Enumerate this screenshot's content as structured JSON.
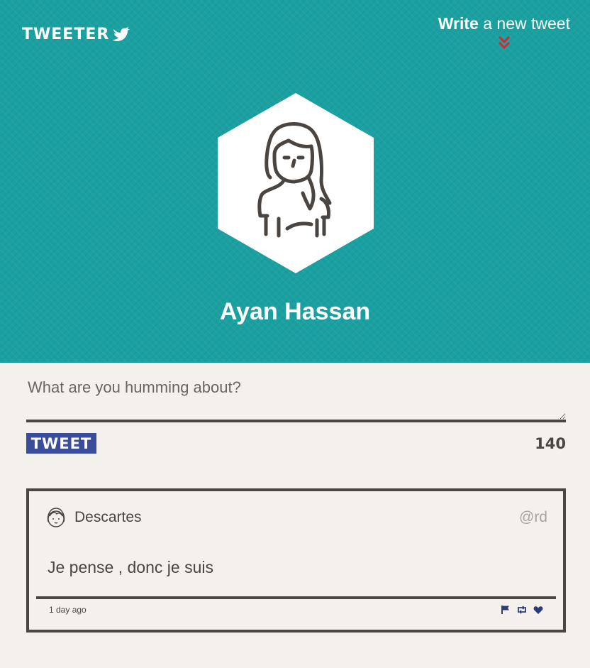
{
  "header": {
    "brand": "TWEETER",
    "write_link": {
      "bold": "Write",
      "rest": " a new tweet"
    }
  },
  "profile": {
    "name": "Ayan Hassan",
    "avatar_icon": "woman-avatar-icon"
  },
  "compose": {
    "placeholder": "What are you humming about?",
    "button_label": "TWEET",
    "counter": "140"
  },
  "tweets": [
    {
      "author": "Descartes",
      "handle": "@rd",
      "content": "Je pense , donc je suis",
      "time": "1 day ago",
      "actions": [
        "flag-icon",
        "retweet-icon",
        "heart-icon"
      ]
    }
  ],
  "colors": {
    "header_bg": "#1aa0a0",
    "page_bg": "#f4f1ec",
    "button_bg": "#3b4c9b",
    "chevron": "#d7282e",
    "dark": "#4a4540",
    "icon_accent": "#2e3a7a"
  }
}
